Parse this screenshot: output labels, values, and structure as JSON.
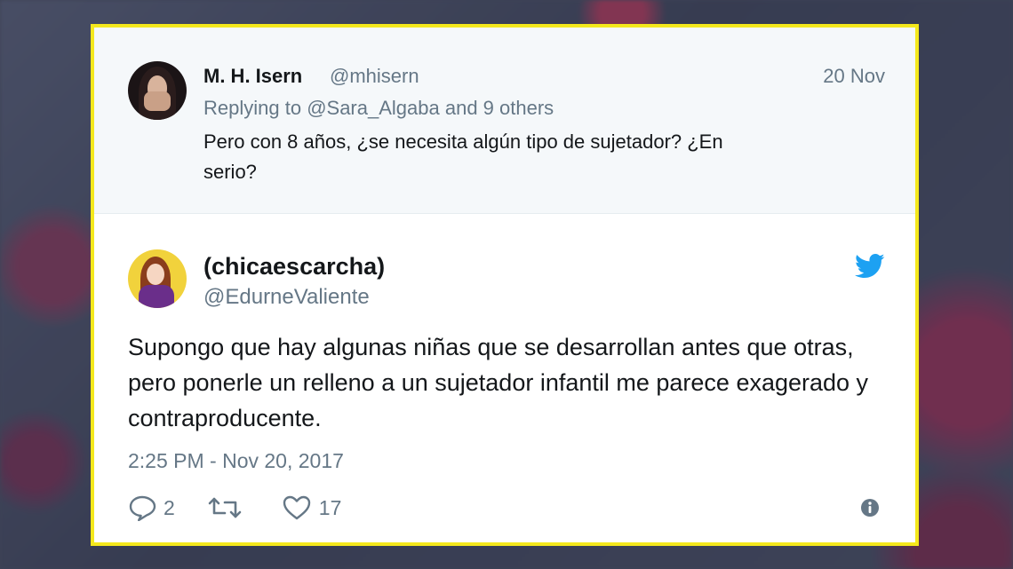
{
  "reply_tweet": {
    "name": "M. H. Isern",
    "handle": "@mhisern",
    "date": "20 Nov",
    "replying_prefix": "Replying to ",
    "replying_to": "@Sara_Algaba",
    "replying_suffix": " and 9 others",
    "text": "Pero con 8 años, ¿se necesita algún tipo de sujetador? ¿En serio?"
  },
  "main_tweet": {
    "name": "(chicaescarcha)",
    "handle": "@EdurneValiente",
    "text": "Supongo que hay algunas niñas que se desarrollan antes que otras, pero ponerle un relleno a un sujetador infantil me parece exagerado y contraproducente.",
    "timestamp": "2:25 PM - Nov 20, 2017",
    "reply_count": "2",
    "like_count": "17"
  },
  "icons": {
    "reply": "reply-icon",
    "retweet": "retweet-icon",
    "like": "heart-icon",
    "info": "info-icon",
    "brand": "twitter-bird-icon"
  },
  "colors": {
    "frame": "#f4e81c",
    "twitter_blue": "#1da1f2",
    "secondary_text": "#657786",
    "primary_text": "#14171a",
    "reply_bg": "#f5f8fa"
  }
}
